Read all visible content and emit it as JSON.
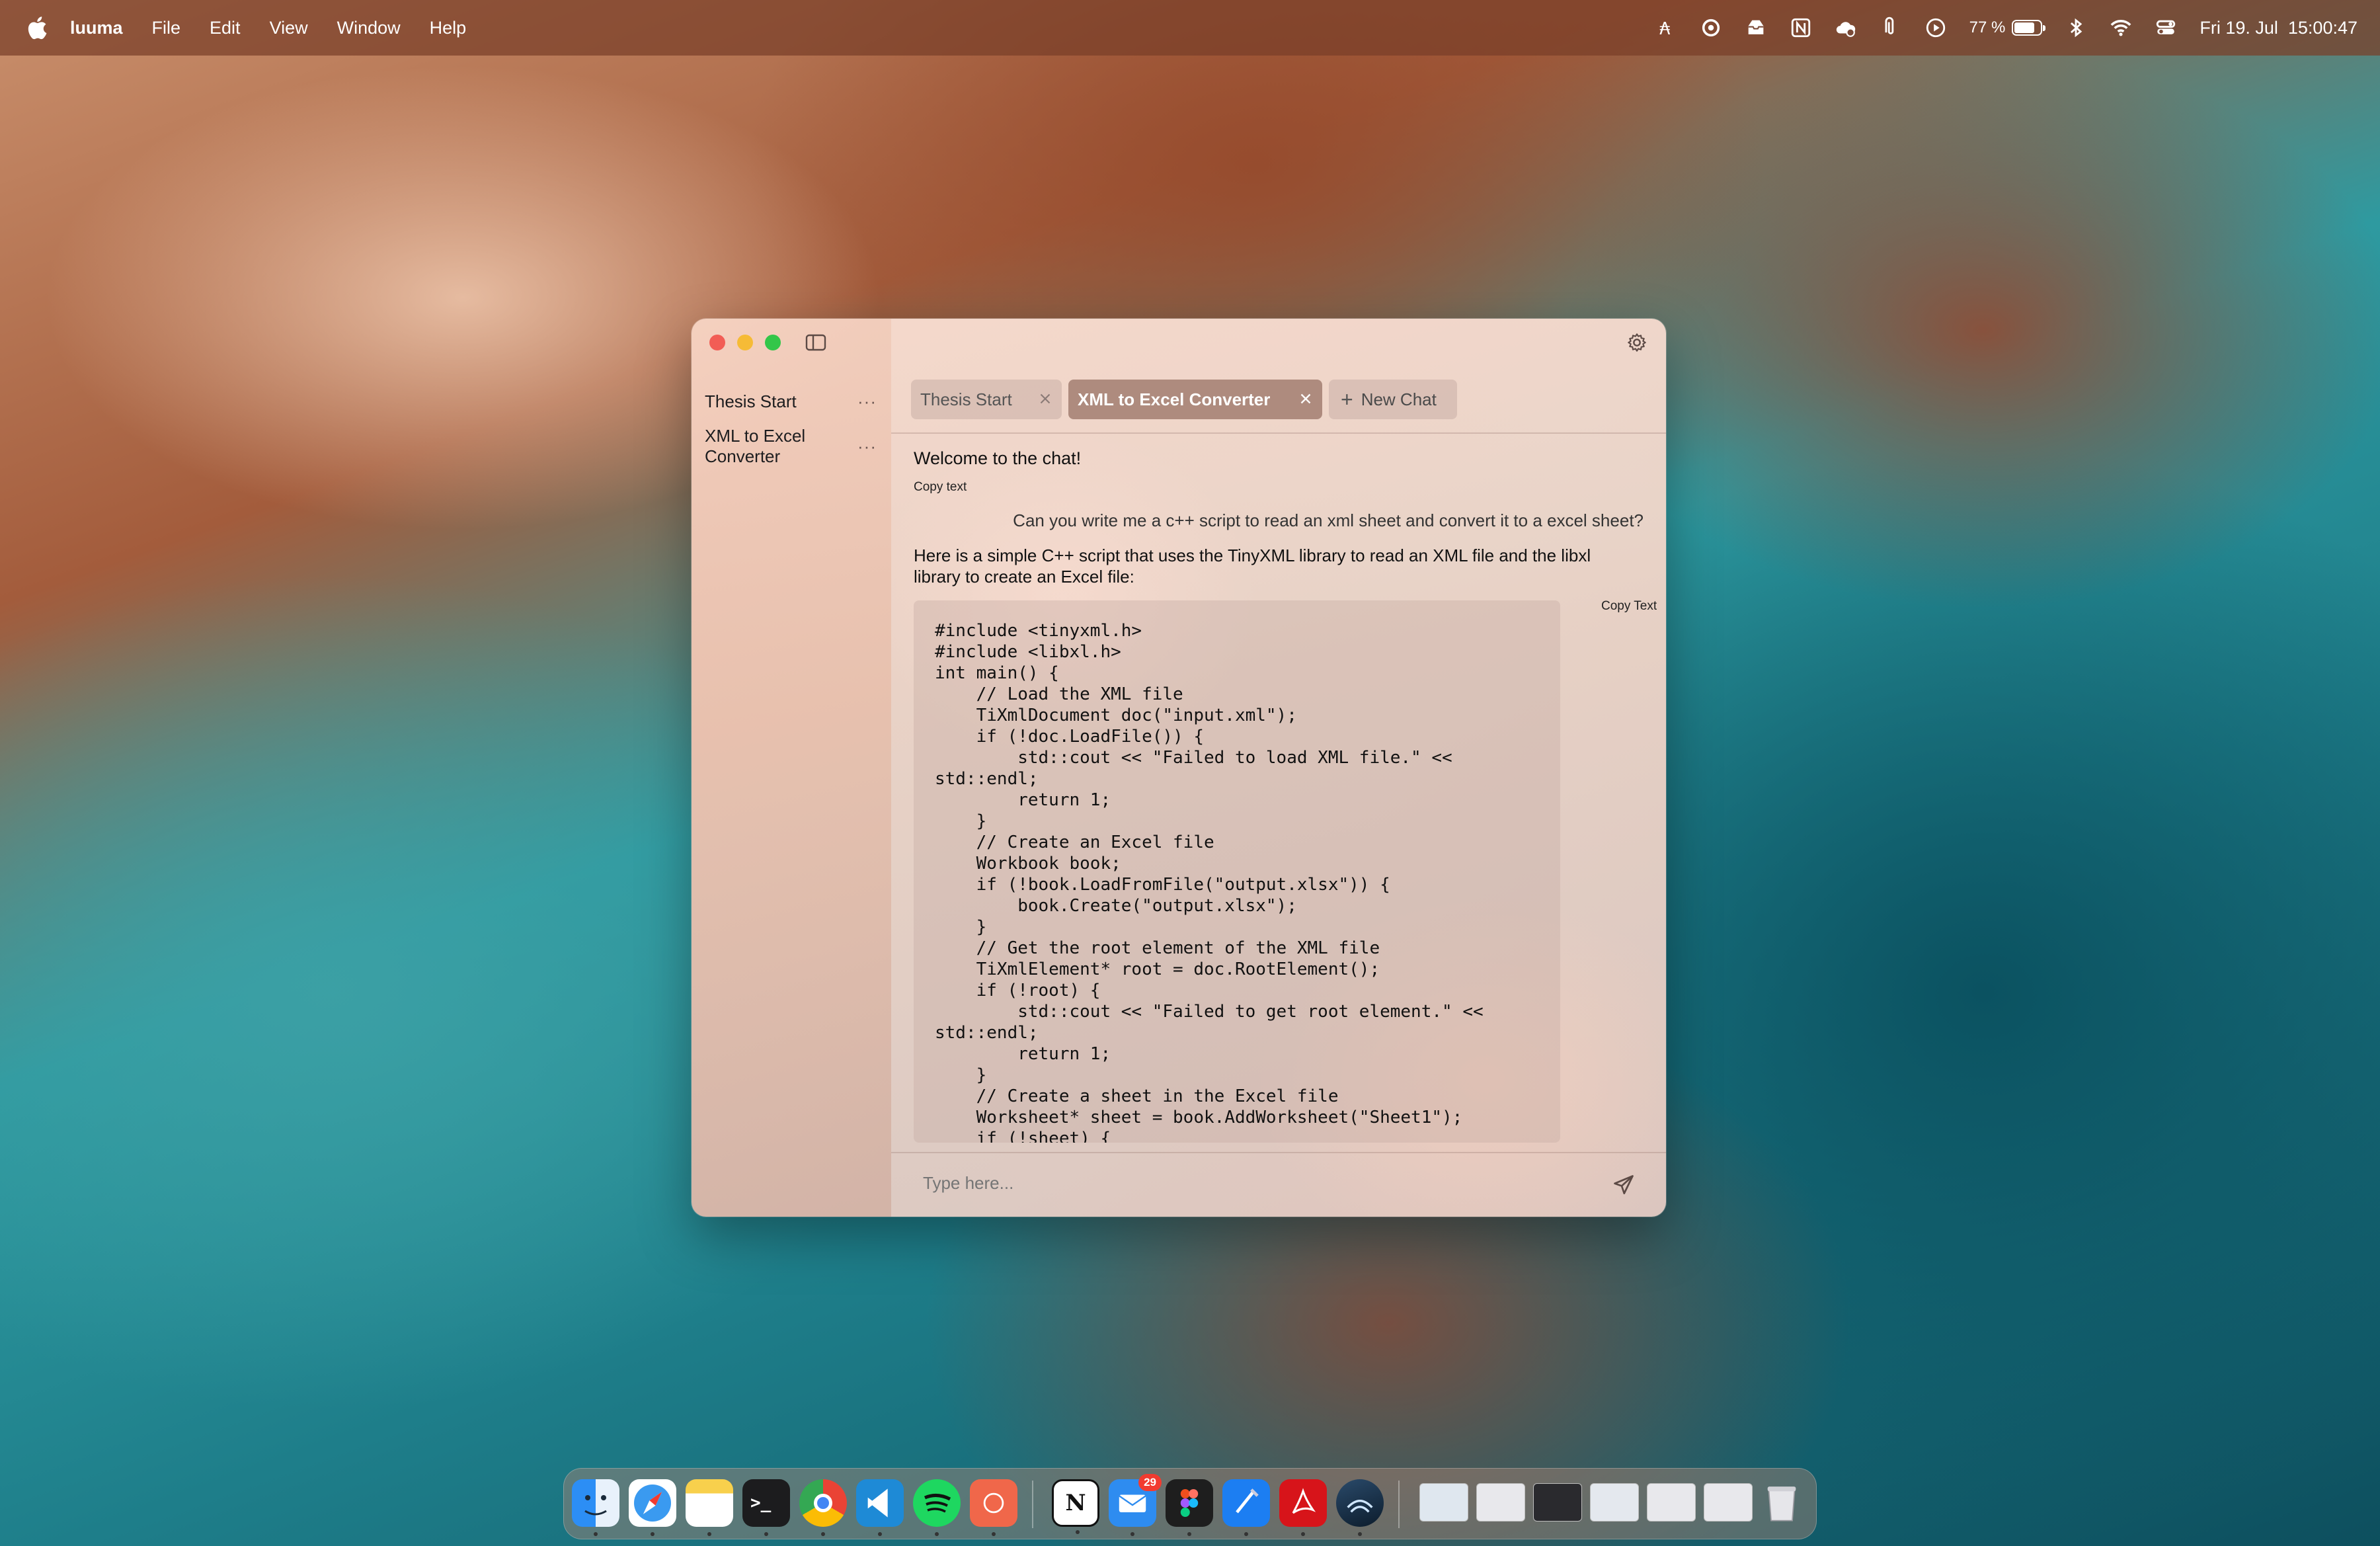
{
  "menubar": {
    "app_name": "luuma",
    "menus": [
      "File",
      "Edit",
      "View",
      "Window",
      "Help"
    ],
    "battery_percent": "77 %",
    "battery_level": 0.77,
    "datetime": "Fri 19. Jul  15:00:47",
    "status_icons": [
      "pen-icon",
      "rotation-icon",
      "inbox-icon",
      "notion-icon",
      "cloud-icon",
      "paperclip-icon",
      "play-icon",
      "battery-icon",
      "bluetooth-icon",
      "wifi-icon",
      "control-center-icon"
    ]
  },
  "sidebar": {
    "items": [
      {
        "label": "Thesis Start",
        "more": "···"
      },
      {
        "label": "XML to Excel Converter",
        "more": "···"
      }
    ]
  },
  "tabs": {
    "items": [
      {
        "label": "Thesis Start",
        "active": false
      },
      {
        "label": "XML to Excel Converter",
        "active": true
      }
    ],
    "new_chat_label": "New Chat"
  },
  "chat": {
    "welcome": "Welcome to the chat!",
    "copy_text_label": "Copy text",
    "user_message": "Can you write me a c++ script to read an xml sheet and convert it to a excel sheet?",
    "assistant_intro": "Here is a simple C++ script that uses the TinyXML library to read an XML file and the libxl library to create an Excel file:",
    "code_copy_label": "Copy Text",
    "code": "#include <tinyxml.h>\n#include <libxl.h>\nint main() {\n    // Load the XML file\n    TiXmlDocument doc(\"input.xml\");\n    if (!doc.LoadFile()) {\n        std::cout << \"Failed to load XML file.\" <<\nstd::endl;\n        return 1;\n    }\n    // Create an Excel file\n    Workbook book;\n    if (!book.LoadFromFile(\"output.xlsx\")) {\n        book.Create(\"output.xlsx\");\n    }\n    // Get the root element of the XML file\n    TiXmlElement* root = doc.RootElement();\n    if (!root) {\n        std::cout << \"Failed to get root element.\" <<\nstd::endl;\n        return 1;\n    }\n    // Create a sheet in the Excel file\n    Worksheet* sheet = book.AddWorksheet(\"Sheet1\");\n    if (!sheet) {"
  },
  "input": {
    "placeholder": "Type here..."
  },
  "dock": {
    "mail_badge": "29",
    "apps": [
      "finder",
      "safari",
      "notes",
      "terminal",
      "chrome",
      "vscode",
      "spotify",
      "vpn",
      "notion",
      "mail",
      "figma",
      "xcode",
      "acrobat",
      "app-store-sonoma"
    ],
    "accent_colors": {
      "red": "#f25d55",
      "yellow": "#f6bb36",
      "green": "#33c649",
      "active_tab": "#9b7669"
    }
  }
}
